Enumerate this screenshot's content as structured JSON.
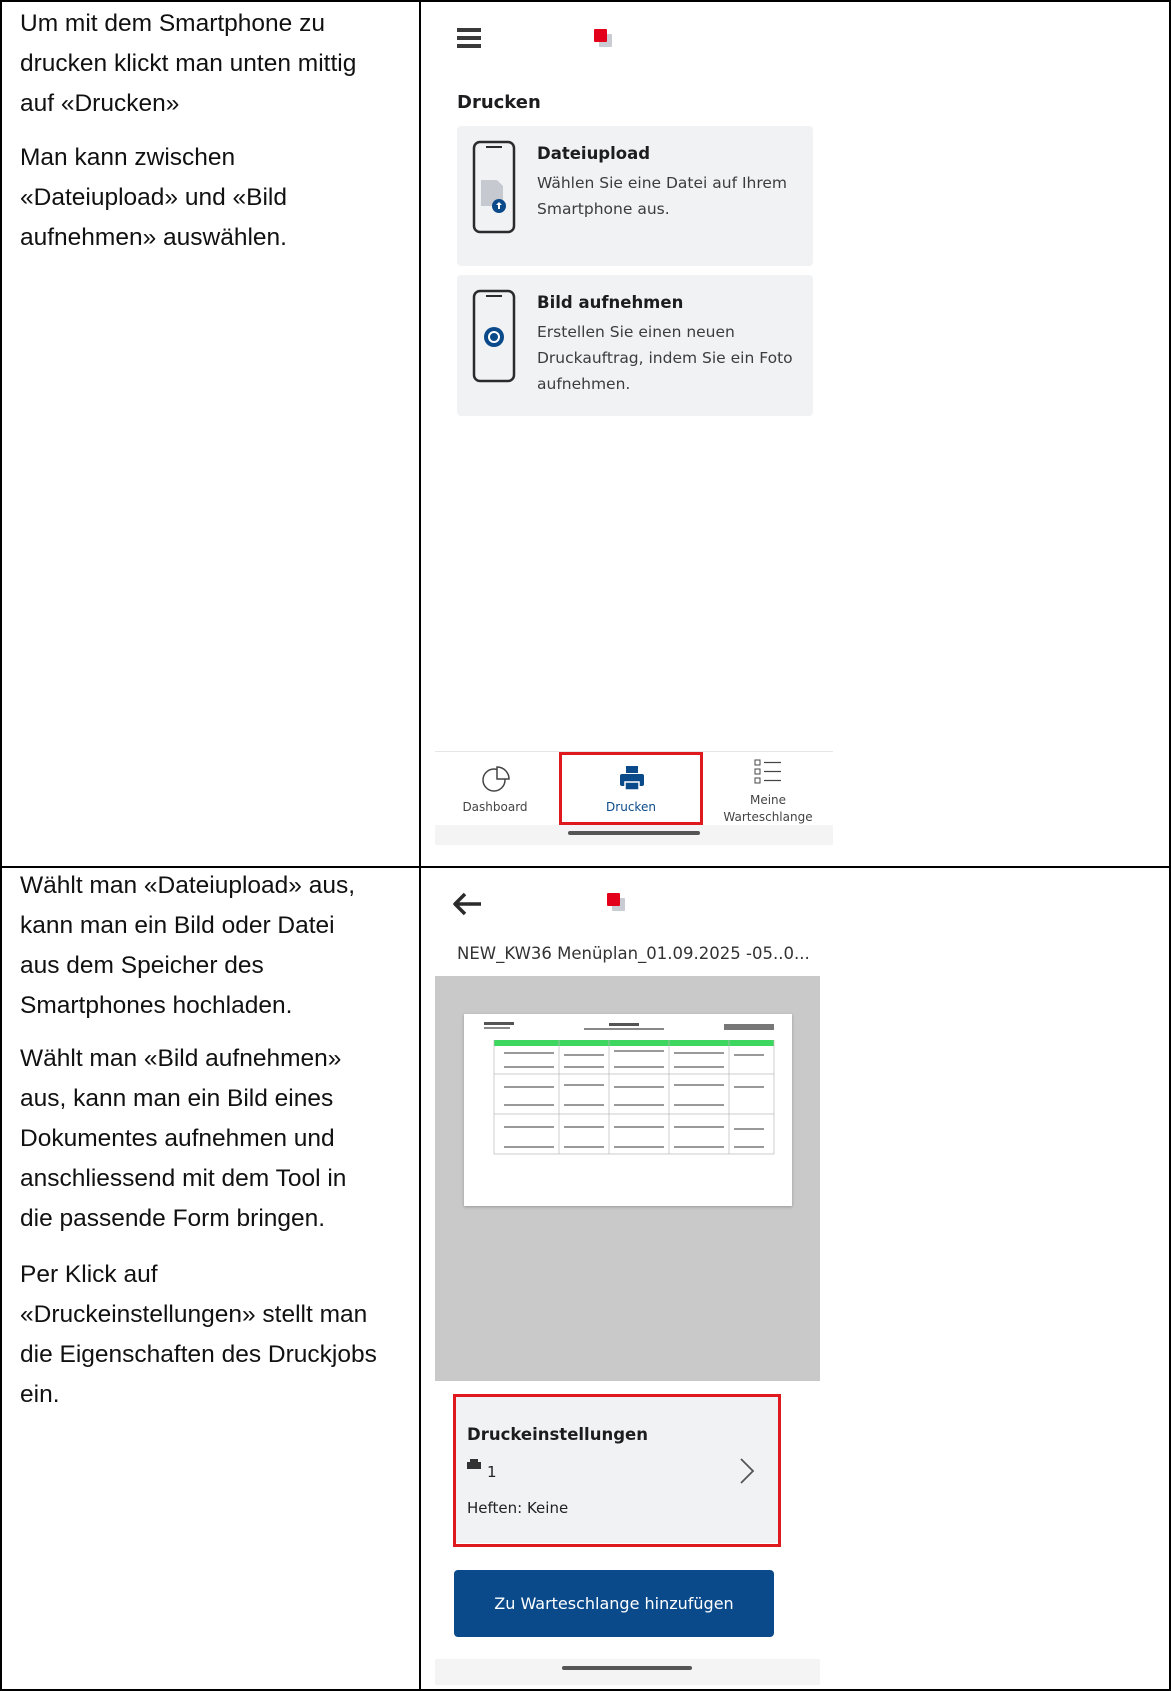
{
  "row1": {
    "paragraphs": [
      [
        "Um mit dem Smartphone zu",
        "drucken klickt man unten mittig",
        "auf «Drucken»"
      ],
      [
        "Man kann zwischen",
        "«Dateiupload» und «Bild",
        "aufnehmen» auswählen."
      ]
    ],
    "phone": {
      "heading": "Drucken",
      "cards": [
        {
          "title": "Dateiupload",
          "desc": [
            "Wählen Sie eine Datei auf Ihrem",
            "Smartphone aus."
          ],
          "icon": "phone-upload-icon"
        },
        {
          "title": "Bild aufnehmen",
          "desc": [
            "Erstellen Sie einen neuen",
            "Druckauftrag, indem Sie ein Foto",
            "aufnehmen."
          ],
          "icon": "phone-camera-icon"
        }
      ],
      "nav": [
        {
          "label": "Dashboard",
          "icon": "pie-chart-icon"
        },
        {
          "label": "Drucken",
          "icon": "printer-icon"
        },
        {
          "label_line1": "Meine",
          "label_line2": "Warteschlange",
          "icon": "list-icon"
        }
      ]
    }
  },
  "row2": {
    "paragraphs": [
      [
        "Wählt man «Dateiupload» aus,",
        "kann man ein Bild oder Datei",
        "aus dem Speicher des",
        "Smartphones hochladen."
      ],
      [
        "Wählt man «Bild aufnehmen»",
        "aus, kann man ein Bild eines",
        "Dokumentes aufnehmen und",
        "anschliessend mit dem Tool in",
        "die passende Form bringen."
      ],
      [
        "Per Klick auf",
        "«Druckeinstellungen» stellt man",
        "die Eigenschaften des Druckjobs",
        "ein."
      ]
    ],
    "phone": {
      "filename": "NEW_KW36 Menüplan_01.09.2025 -05..0...",
      "settings_title": "Druckeinstellungen",
      "copies": "1",
      "staple": "Heften: Keine",
      "button": "Zu Warteschlange hinzufügen"
    }
  },
  "colors": {
    "accent_red": "#e3001b",
    "highlight_red": "#e0191f",
    "primary_blue": "#0a4a8b",
    "card_bg": "#f1f2f4"
  }
}
